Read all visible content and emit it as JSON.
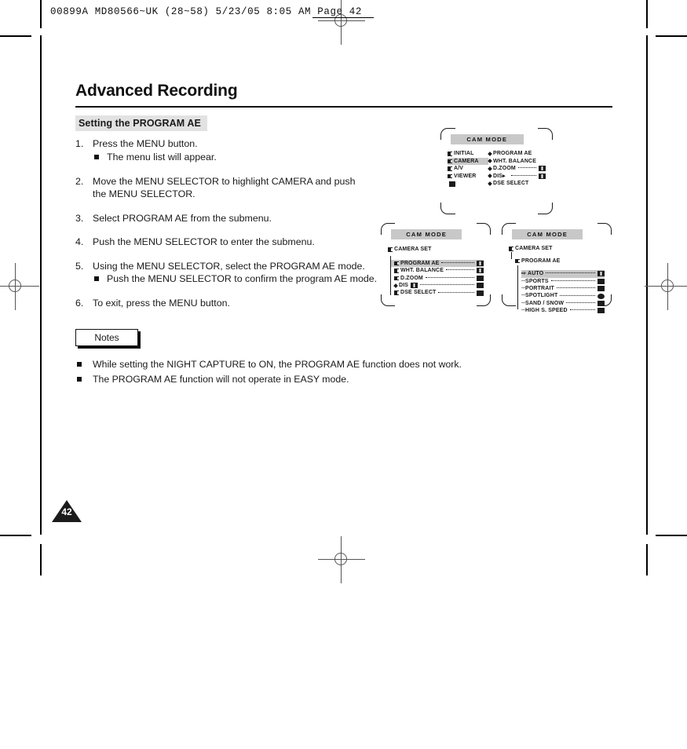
{
  "print": {
    "slug": "00899A MD80566~UK  (28~58)   5/23/05 8:05 AM   Page 42"
  },
  "page": {
    "title": "Advanced Recording",
    "section_heading": "Setting the PROGRAM AE",
    "number": "42"
  },
  "steps": [
    {
      "num": "1.",
      "text": "Press the MENU button.",
      "sub": [
        "The menu list will appear."
      ]
    },
    {
      "num": "2.",
      "text": "Move the MENU SELECTOR to highlight CAMERA and push the MENU SELECTOR.",
      "sub": []
    },
    {
      "num": "3.",
      "text": "Select PROGRAM AE from the submenu.",
      "sub": []
    },
    {
      "num": "4.",
      "text": "Push the MENU SELECTOR to enter the submenu.",
      "sub": []
    },
    {
      "num": "5.",
      "text": "Using the MENU SELECTOR, select the PROGRAM AE mode.",
      "sub": [
        "Push the MENU SELECTOR to confirm the program AE mode."
      ]
    },
    {
      "num": "6.",
      "text": "To exit, press the MENU button.",
      "sub": []
    }
  ],
  "notes": {
    "label": "Notes",
    "items": [
      "While setting the NIGHT CAPTURE to ON, the PROGRAM AE function does not work.",
      "The PROGRAM AE function will not operate in EASY mode."
    ]
  },
  "lcd_main_menu": {
    "titlebar": "CAM  MODE",
    "left_items": [
      {
        "label": "INITIAL",
        "selected": false
      },
      {
        "label": "CAMERA",
        "selected": true
      },
      {
        "label": "A/V",
        "selected": false
      },
      {
        "label": "VIEWER",
        "selected": false
      }
    ],
    "right_items": [
      {
        "label": "PROGRAM AE",
        "dots": false,
        "value": ""
      },
      {
        "label": "WHT. BALANCE",
        "dots": false,
        "value": ""
      },
      {
        "label": "D.ZOOM",
        "dots": true,
        "value": "off-swatch"
      },
      {
        "label": "DIS",
        "dots": true,
        "value": "off-swatch"
      },
      {
        "label": "DSE SELECT",
        "dots": false,
        "value": ""
      }
    ]
  },
  "lcd_camera_set": {
    "titlebar": "CAM  MODE",
    "breadcrumb": "CAMERA SET",
    "items": [
      {
        "label": "PROGRAM AE",
        "selected": true,
        "value": "half-swatch"
      },
      {
        "label": "WHT. BALANCE",
        "selected": false,
        "value": "half-swatch"
      },
      {
        "label": "D.ZOOM",
        "selected": false,
        "value": "off-swatch"
      },
      {
        "label": "DIS",
        "selected": false,
        "value": "on-swatch"
      },
      {
        "label": "DSE SELECT",
        "selected": false,
        "value": "on-swatch"
      }
    ]
  },
  "lcd_program_ae": {
    "titlebar": "CAM  MODE",
    "breadcrumb": "CAMERA SET",
    "submenu": "PROGRAM AE",
    "options": [
      {
        "label": "AUTO",
        "selected": true
      },
      {
        "label": "SPORTS",
        "selected": false
      },
      {
        "label": "PORTRAIT",
        "selected": false
      },
      {
        "label": "SPOTLIGHT",
        "selected": false
      },
      {
        "label": "SAND / SNOW",
        "selected": false
      },
      {
        "label": "HIGH S. SPEED",
        "selected": false
      }
    ]
  },
  "colors": {
    "highlight": "#c8c8c8",
    "section_bg": "#e2e2e2",
    "ink": "#1b1b1b"
  }
}
